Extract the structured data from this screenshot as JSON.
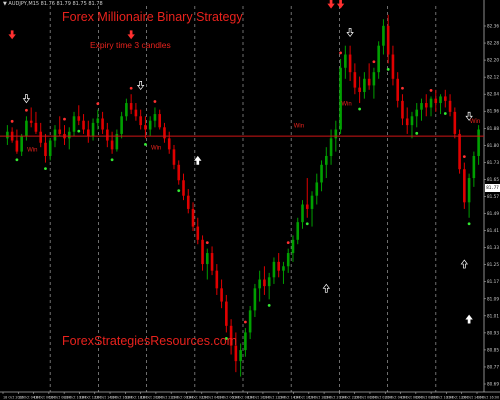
{
  "chart_data": {
    "type": "candlestick",
    "header_text": "▼ AUDJPY,M15  81.76 81.79 81.75 81.78",
    "title": "Forex Millionaire Binary Strategy",
    "subtitle": "Expiry time 3 candles",
    "watermark": "ForexStrategiesResources.com",
    "current_price": 81.77,
    "current_price_label": "81.77",
    "ylim": [
      80.61,
      82.36
    ],
    "y_ticks": [
      "82.36",
      "82.28",
      "82.20",
      "82.12",
      "82.04",
      "81.96",
      "81.88",
      "81.80",
      "81.73",
      "81.65",
      "81.57",
      "81.49",
      "81.41",
      "81.33",
      "81.25",
      "81.17",
      "81.09",
      "81.01",
      "80.93",
      "80.85",
      "80.77",
      "80.69"
    ],
    "x_ticks": [
      "18 Oct 2016",
      "18 Oct 04:00",
      "18 Oct 06:00",
      "18 Oct 08:00",
      "18 Oct 10:00",
      "18 Oct 12:00",
      "18 Oct 14:00",
      "18 Oct 16:00",
      "18 Oct 18:00",
      "18 Oct 20:00",
      "18 Oct 22:00",
      "19 Oct 00:00",
      "19 Oct 02:00",
      "19 Oct 04:00",
      "19 Oct 06:00",
      "19 Oct 08:00",
      "19 Oct 10:00",
      "19 Oct 12:00",
      "19 Oct 14:00",
      "19 Oct 16:00",
      "19 Oct 18:00",
      "19 Oct 20:00",
      "19 Oct 22:00",
      "20 Oct 00:00",
      "20 Oct 02:00",
      "20 Oct 04:00",
      "20 Oct 06:00",
      "20 Oct 08:00",
      "20 Oct 10:00",
      "20 Oct 12:00",
      "20 Oct 14:00",
      "20 Oct 16:00"
    ],
    "period_separators": 9,
    "grid": false,
    "series": [
      {
        "candles": [
          [
            81.76,
            81.82,
            81.73,
            81.79
          ],
          [
            81.79,
            81.81,
            81.74,
            81.75
          ],
          [
            81.75,
            81.8,
            81.69,
            81.7
          ],
          [
            81.7,
            81.78,
            81.68,
            81.77
          ],
          [
            81.77,
            81.86,
            81.75,
            81.84
          ],
          [
            81.84,
            81.9,
            81.81,
            81.83
          ],
          [
            81.83,
            81.88,
            81.78,
            81.79
          ],
          [
            81.79,
            81.83,
            81.72,
            81.74
          ],
          [
            81.74,
            81.78,
            81.65,
            81.68
          ],
          [
            81.68,
            81.76,
            81.66,
            81.75
          ],
          [
            81.75,
            81.82,
            81.72,
            81.8
          ],
          [
            81.8,
            81.86,
            81.77,
            81.78
          ],
          [
            81.78,
            81.82,
            81.73,
            81.76
          ],
          [
            81.76,
            81.81,
            81.71,
            81.79
          ],
          [
            81.79,
            81.88,
            81.77,
            81.86
          ],
          [
            81.86,
            81.91,
            81.82,
            81.84
          ],
          [
            81.84,
            81.87,
            81.78,
            81.8
          ],
          [
            81.8,
            81.84,
            81.74,
            81.77
          ],
          [
            81.77,
            81.85,
            81.75,
            81.83
          ],
          [
            81.83,
            81.89,
            81.8,
            81.85
          ],
          [
            81.85,
            81.88,
            81.78,
            81.8
          ],
          [
            81.8,
            81.83,
            81.72,
            81.75
          ],
          [
            81.75,
            81.79,
            81.69,
            81.71
          ],
          [
            81.71,
            81.8,
            81.7,
            81.78
          ],
          [
            81.78,
            81.88,
            81.76,
            81.86
          ],
          [
            81.86,
            81.94,
            81.84,
            81.92
          ],
          [
            81.92,
            81.96,
            81.87,
            81.89
          ],
          [
            81.89,
            81.92,
            81.84,
            81.86
          ],
          [
            81.86,
            81.89,
            81.8,
            81.82
          ],
          [
            81.82,
            81.86,
            81.76,
            81.8
          ],
          [
            81.8,
            81.86,
            81.77,
            81.84
          ],
          [
            81.84,
            81.9,
            81.81,
            81.87
          ],
          [
            81.87,
            81.89,
            81.8,
            81.81
          ],
          [
            81.81,
            81.83,
            81.74,
            81.76
          ],
          [
            81.76,
            81.79,
            81.69,
            81.71
          ],
          [
            81.71,
            81.73,
            81.62,
            81.64
          ],
          [
            81.64,
            81.66,
            81.55,
            81.57
          ],
          [
            81.57,
            81.6,
            81.48,
            81.5
          ],
          [
            81.5,
            81.53,
            81.42,
            81.44
          ],
          [
            81.44,
            81.47,
            81.34,
            81.36
          ],
          [
            81.36,
            81.4,
            81.28,
            81.3
          ],
          [
            81.3,
            81.32,
            81.16,
            81.19
          ],
          [
            81.19,
            81.26,
            81.12,
            81.24
          ],
          [
            81.24,
            81.27,
            81.14,
            81.16
          ],
          [
            81.16,
            81.19,
            81.05,
            81.08
          ],
          [
            81.08,
            81.12,
            80.99,
            81.02
          ],
          [
            81.02,
            81.05,
            80.88,
            80.91
          ],
          [
            80.91,
            80.94,
            80.78,
            80.82
          ],
          [
            80.82,
            80.88,
            80.7,
            80.75
          ],
          [
            80.75,
            80.83,
            80.68,
            80.8
          ],
          [
            80.8,
            80.9,
            80.77,
            80.88
          ],
          [
            80.88,
            81.0,
            80.85,
            80.98
          ],
          [
            80.98,
            81.1,
            80.95,
            81.08
          ],
          [
            81.08,
            81.16,
            81.02,
            81.12
          ],
          [
            81.12,
            81.18,
            81.05,
            81.09
          ],
          [
            81.09,
            81.15,
            81.03,
            81.13
          ],
          [
            81.13,
            81.22,
            81.1,
            81.2
          ],
          [
            81.2,
            81.24,
            81.13,
            81.16
          ],
          [
            81.16,
            81.2,
            81.1,
            81.18
          ],
          [
            81.18,
            81.26,
            81.15,
            81.24
          ],
          [
            81.24,
            81.32,
            81.2,
            81.3
          ],
          [
            81.3,
            81.4,
            81.28,
            81.38
          ],
          [
            81.38,
            81.48,
            81.35,
            81.46
          ],
          [
            81.46,
            81.58,
            81.4,
            81.44
          ],
          [
            81.44,
            81.52,
            81.36,
            81.5
          ],
          [
            81.5,
            81.6,
            81.46,
            81.56
          ],
          [
            81.56,
            81.66,
            81.52,
            81.64
          ],
          [
            81.64,
            81.72,
            81.58,
            81.68
          ],
          [
            81.68,
            81.8,
            81.64,
            81.76
          ],
          [
            81.76,
            81.84,
            81.7,
            81.8
          ],
          [
            81.8,
            82.12,
            81.78,
            82.08
          ],
          [
            82.08,
            82.18,
            82.03,
            82.14
          ],
          [
            82.14,
            82.18,
            82.02,
            82.06
          ],
          [
            82.06,
            82.1,
            81.96,
            81.99
          ],
          [
            81.99,
            82.04,
            81.92,
            81.97
          ],
          [
            81.97,
            82.06,
            81.94,
            82.03
          ],
          [
            82.03,
            82.1,
            81.98,
            82.0
          ],
          [
            82.0,
            82.08,
            81.94,
            82.06
          ],
          [
            82.06,
            82.2,
            82.03,
            82.18
          ],
          [
            82.18,
            82.3,
            82.14,
            82.27
          ],
          [
            82.27,
            82.32,
            82.1,
            82.14
          ],
          [
            82.14,
            82.18,
            82.0,
            82.03
          ],
          [
            82.03,
            82.06,
            81.9,
            81.93
          ],
          [
            81.93,
            81.96,
            81.82,
            81.85
          ],
          [
            81.85,
            81.9,
            81.78,
            81.82
          ],
          [
            81.82,
            81.88,
            81.76,
            81.86
          ],
          [
            81.86,
            81.92,
            81.81,
            81.89
          ],
          [
            81.89,
            81.94,
            81.84,
            81.92
          ],
          [
            81.92,
            81.96,
            81.86,
            81.9
          ],
          [
            81.9,
            81.95,
            81.86,
            81.94
          ],
          [
            81.94,
            81.98,
            81.88,
            81.92
          ],
          [
            81.92,
            81.96,
            81.87,
            81.95
          ],
          [
            81.95,
            81.98,
            81.9,
            81.93
          ],
          [
            81.93,
            81.96,
            81.86,
            81.88
          ],
          [
            81.88,
            81.9,
            81.76,
            81.78
          ],
          [
            81.78,
            81.8,
            81.6,
            81.62
          ],
          [
            81.62,
            81.65,
            81.44,
            81.47
          ],
          [
            81.47,
            81.6,
            81.4,
            81.58
          ],
          [
            81.58,
            81.7,
            81.54,
            81.68
          ],
          [
            81.68,
            81.82,
            81.64,
            81.8
          ]
        ]
      }
    ],
    "signals": [
      {
        "type": "sell",
        "index": 1
      },
      {
        "type": "buy",
        "index": 2
      },
      {
        "type": "sell",
        "index": 4
      },
      {
        "type": "buy",
        "index": 8
      },
      {
        "type": "sell",
        "index": 12
      },
      {
        "type": "buy",
        "index": 15
      },
      {
        "type": "sell",
        "index": 19
      },
      {
        "type": "buy",
        "index": 22
      },
      {
        "type": "sell",
        "index": 26
      },
      {
        "type": "buy",
        "index": 29
      },
      {
        "type": "sell",
        "index": 31
      },
      {
        "type": "buy",
        "index": 36
      },
      {
        "type": "sell",
        "index": 42
      },
      {
        "type": "buy",
        "index": 46
      },
      {
        "type": "sell",
        "index": 50
      },
      {
        "type": "buy",
        "index": 55
      },
      {
        "type": "sell",
        "index": 59
      },
      {
        "type": "buy",
        "index": 63
      },
      {
        "type": "sell",
        "index": 70
      },
      {
        "type": "buy",
        "index": 74
      },
      {
        "type": "sell",
        "index": 77
      },
      {
        "type": "buy",
        "index": 80
      },
      {
        "type": "sell",
        "index": 83
      },
      {
        "type": "buy",
        "index": 86
      },
      {
        "type": "sell",
        "index": 89
      },
      {
        "type": "buy",
        "index": 92
      },
      {
        "type": "sell",
        "index": 96
      },
      {
        "type": "buy",
        "index": 97
      }
    ],
    "arrows": [
      {
        "dir": "down",
        "style": "solid-red",
        "index": 1,
        "price": 82.23
      },
      {
        "dir": "down",
        "style": "solid-red",
        "index": 26,
        "price": 82.23
      },
      {
        "dir": "down",
        "style": "solid-red",
        "index": 68,
        "price": 82.42
      },
      {
        "dir": "down",
        "style": "solid-red",
        "index": 70,
        "price": 82.43
      },
      {
        "dir": "down",
        "style": "hollow-white",
        "index": 4,
        "price": 81.94
      },
      {
        "dir": "down",
        "style": "hollow-white",
        "index": 28,
        "price": 82.0
      },
      {
        "dir": "down",
        "style": "hollow-white",
        "index": 72,
        "price": 82.24
      },
      {
        "dir": "down",
        "style": "hollow-white",
        "index": 97,
        "price": 81.86
      },
      {
        "dir": "up",
        "style": "solid-white",
        "index": 40,
        "price": 81.66
      },
      {
        "dir": "up",
        "style": "solid-white",
        "index": 97,
        "price": 80.94
      },
      {
        "dir": "up",
        "style": "hollow-white",
        "index": 67,
        "price": 81.08
      },
      {
        "dir": "up",
        "style": "hollow-white",
        "index": 96,
        "price": 81.19
      }
    ],
    "labels": [
      {
        "text": "Win",
        "index": 5,
        "price": 81.7
      },
      {
        "text": "Win",
        "index": 31,
        "price": 81.71
      },
      {
        "text": "Win",
        "index": 61,
        "price": 81.81
      },
      {
        "text": "Win",
        "index": 71,
        "price": 81.91
      },
      {
        "text": "Win",
        "index": 98,
        "price": 81.83
      }
    ],
    "colors": {
      "background": "#000000",
      "bull_candle": "#00a000",
      "bear_candle": "#e00000",
      "buy_dot": "#32e832",
      "sell_dot": "#ff3030",
      "price_line": "#d01515",
      "separator": "#8a8a8a",
      "axis": "#b0b0b0",
      "text_red": "#e8221d",
      "label_red": "#e8221d"
    }
  }
}
